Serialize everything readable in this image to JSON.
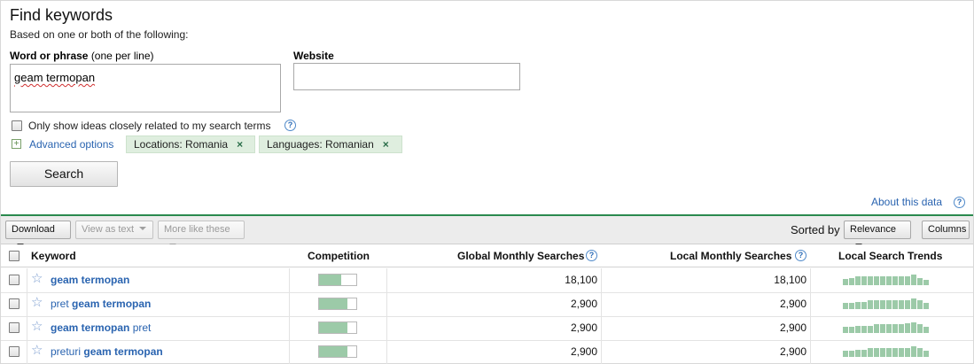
{
  "header": {
    "title": "Find keywords",
    "subtitle": "Based on one or both of the following:"
  },
  "form": {
    "word_label": "Word or phrase",
    "word_hint": "(one per line)",
    "word_value": "geam termopan",
    "website_label": "Website",
    "website_value": "",
    "only_ideas_label": "Only show ideas closely related to my search terms",
    "only_ideas_checked": false,
    "advanced_options": "Advanced options",
    "filters": [
      {
        "label": "Locations: Romania",
        "remove": "×"
      },
      {
        "label": "Languages: Romanian",
        "remove": "×"
      }
    ],
    "search_button": "Search"
  },
  "about_link": "About this data",
  "help_glyph": "?",
  "toolbar": {
    "download": "Download",
    "view_as_text": "View as text",
    "more_like_these": "More like these",
    "sorted_by_label": "Sorted by",
    "sort_value": "Relevance",
    "columns": "Columns"
  },
  "table": {
    "columns": [
      "Keyword",
      "Competition",
      "Global Monthly Searches",
      "Local Monthly Searches",
      "Local Search Trends"
    ],
    "rows": [
      {
        "keyword_pre": "",
        "keyword_bold": "geam termopan",
        "keyword_post": "",
        "competition": 0.6,
        "global": "18,100",
        "local": "18,100",
        "trend": [
          0.6,
          0.7,
          0.8,
          0.8,
          0.8,
          0.8,
          0.8,
          0.8,
          0.8,
          0.8,
          0.8,
          1.0,
          0.7,
          0.5
        ]
      },
      {
        "keyword_pre": "pret ",
        "keyword_bold": "geam termopan",
        "keyword_post": "",
        "competition": 0.75,
        "global": "2,900",
        "local": "2,900",
        "trend": [
          0.6,
          0.6,
          0.7,
          0.7,
          0.8,
          0.8,
          0.8,
          0.8,
          0.8,
          0.8,
          0.8,
          1.0,
          0.8,
          0.6
        ]
      },
      {
        "keyword_pre": "",
        "keyword_bold": "geam termopan",
        "keyword_post": " pret",
        "competition": 0.75,
        "global": "2,900",
        "local": "2,900",
        "trend": [
          0.6,
          0.6,
          0.7,
          0.7,
          0.7,
          0.8,
          0.8,
          0.8,
          0.8,
          0.8,
          0.9,
          1.0,
          0.8,
          0.6
        ]
      },
      {
        "keyword_pre": "preturi ",
        "keyword_bold": "geam termopan",
        "keyword_post": "",
        "competition": 0.75,
        "global": "2,900",
        "local": "2,900",
        "trend": [
          0.6,
          0.6,
          0.7,
          0.7,
          0.8,
          0.8,
          0.8,
          0.8,
          0.8,
          0.8,
          0.8,
          1.0,
          0.8,
          0.6
        ]
      }
    ]
  },
  "icons": {
    "star": "star-outline-icon",
    "help": "help-circle-icon",
    "plus": "expand-plus-icon",
    "close": "close-x-icon"
  },
  "colors": {
    "accent_green": "#2a8a4e",
    "link_blue": "#2a64b0",
    "bar_green": "#9ccaa8",
    "pill_bg": "#dfeedf"
  }
}
